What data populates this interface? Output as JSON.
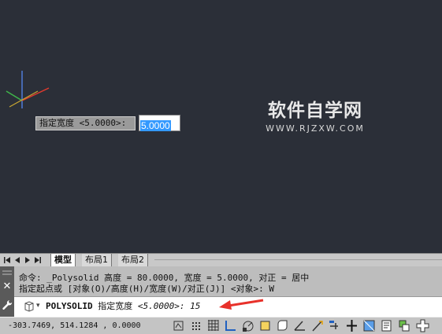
{
  "canvas": {
    "background": "#2b2f38",
    "dynamic_input": {
      "prompt": "指定宽度 <5.0000>:",
      "value": "5.0000"
    },
    "watermark": {
      "title": "软件自学网",
      "url": "WWW.RJZXW.COM"
    }
  },
  "layout_tabs": {
    "nav_icons": [
      "first-arrow-icon",
      "prev-arrow-icon",
      "next-arrow-icon",
      "last-arrow-icon"
    ],
    "tabs": [
      "模型",
      "布局1",
      "布局2"
    ],
    "active": "模型"
  },
  "command": {
    "history": [
      "命令: _Polysolid 高度 = 80.0000, 宽度 = 5.0000, 对正 = 居中",
      "指定起点或 [对象(O)/高度(H)/宽度(W)/对正(J)] <对象>: W"
    ],
    "current": {
      "command": "POLYSOLID",
      "prompt": "指定宽度",
      "default": "<5.0000>:",
      "input": "15"
    },
    "close_icon": "close-icon",
    "customize_icon": "wrench-icon"
  },
  "status_bar": {
    "coordinates": "-303.7469, 514.1284 , 0.0000",
    "toggles": [
      "model-space-icon",
      "snap-icon",
      "grid-icon",
      "ortho-icon",
      "polar-icon",
      "osnap-icon",
      "3d-osnap-icon",
      "otrack-icon",
      "ucs-icon",
      "dynamic-input-icon",
      "lineweight-icon",
      "transparency-icon",
      "quick-properties-icon",
      "selection-cycling-icon",
      "annotation-icon"
    ]
  },
  "colors": {
    "canvas": "#2b2f38",
    "selection": "#3399ff",
    "arrow": "#e8312a"
  }
}
